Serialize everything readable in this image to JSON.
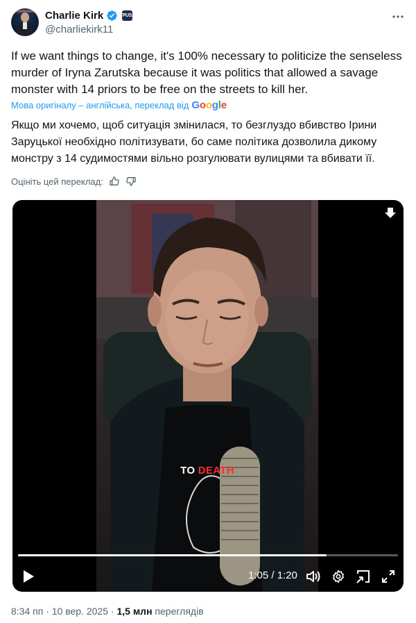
{
  "author": {
    "name": "Charlie Kirk",
    "handle": "@charliekirk11"
  },
  "tweet": {
    "text": "If we want things to change, it's 100% necessary to politicize the senseless murder of Iryna Zarutska because it was politics that allowed a savage monster with 14 priors to be free on the streets to kill her.",
    "translation_note": "Мова оригіналу – англійська, переклад від",
    "translation_provider": "Google",
    "translated_text": "Якщо ми хочемо, щоб ситуація змінилася, то безглуздо вбивство Ірини Заруцької необхідно політизувати, бо саме політика дозволила дикому монстру з 14 судимостями вільно розгулювати вулицями та вбивати її.",
    "rate_label": "Оцініть цей переклад:"
  },
  "video": {
    "caption_word_1": "TO",
    "caption_word_2": "DEATH",
    "time_current": "1:05",
    "time_total": "1:20",
    "time_display": "1:05 / 1:20",
    "progress_fraction": 0.8125
  },
  "footer": {
    "time": "8:34 пп",
    "date": "10 вер. 2025",
    "views_count": "1,5 млн",
    "views_label": "переглядів"
  },
  "icons": {
    "verified": "verified-badge-icon",
    "affiliation": "affiliation-badge-icon",
    "more": "more-options-icon",
    "thumb_up": "thumbs-up-icon",
    "thumb_down": "thumbs-down-icon",
    "download": "download-icon",
    "play": "play-icon",
    "volume": "volume-icon",
    "settings": "settings-gear-icon",
    "pip": "picture-in-picture-icon",
    "fullscreen": "fullscreen-icon"
  },
  "colors": {
    "link": "#1d9bf0",
    "secondary_text": "#536471",
    "primary_text": "#0f1419",
    "caption_highlight": "#ff2a2a"
  }
}
